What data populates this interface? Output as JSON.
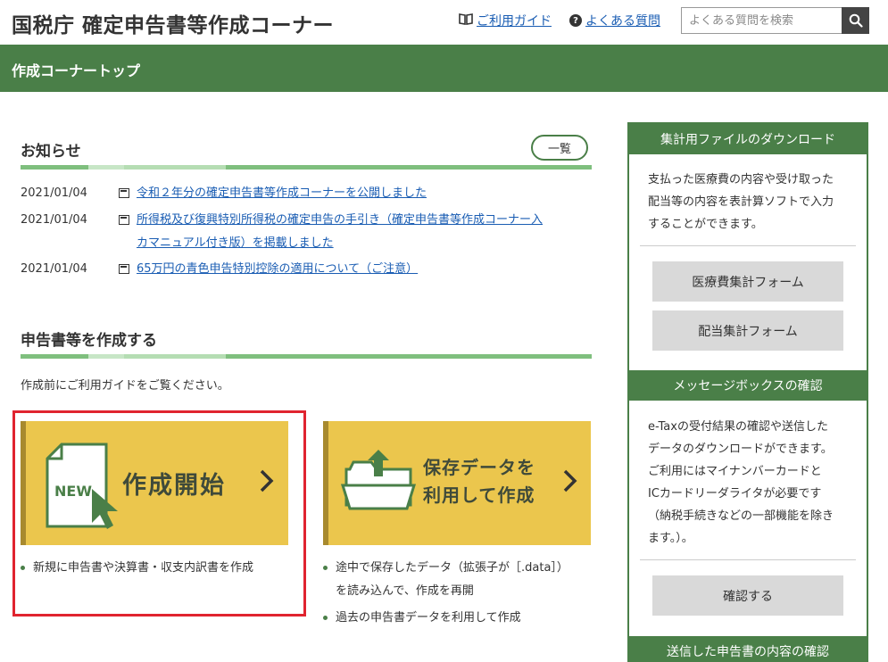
{
  "header": {
    "site_title": "国税庁 確定申告書等作成コーナー",
    "guide_link": "ご利用ガイド",
    "faq_link": "よくある質問",
    "search_placeholder": "よくある質問を検索"
  },
  "nav": {
    "current": "作成コーナートップ"
  },
  "news": {
    "title": "お知らせ",
    "list_button": "一覧",
    "items": [
      {
        "date": "2021/01/04",
        "text": "令和２年分の確定申告書等作成コーナーを公開しました"
      },
      {
        "date": "2021/01/04",
        "line1": "所得税及び復興特別所得税の確定申告の手引き（確定申告書等作成コーナー入",
        "line2": "カマニュアル付き版）を掲載しました"
      },
      {
        "date": "2021/01/04",
        "text": "65万円の青色申告特別控除の適用について（ご注意）"
      }
    ]
  },
  "create": {
    "title": "申告書等を作成する",
    "guide_text": "作成前にご利用ガイドをご覧ください。",
    "new_card": {
      "badge": "NEW",
      "title": "作成開始",
      "desc": "新規に申告書や決算書・収支内訳書を作成"
    },
    "saved_card": {
      "title_line1": "保存データを",
      "title_line2": "利用して作成",
      "desc1_line1": "途中で保存したデータ（拡張子が［.data］）",
      "desc1_line2": "を読み込んで、作成を再開",
      "desc2": "過去の申告書データを利用して作成"
    }
  },
  "sidebar": {
    "download": {
      "title": "集計用ファイルのダウンロード",
      "text_lines": [
        "支払った医療費の内容や受け取った",
        "配当等の内容を表計算ソフトで入力",
        "することができます。"
      ],
      "btn_medical": "医療費集計フォーム",
      "btn_dividend": "配当集計フォーム"
    },
    "messagebox": {
      "title": "メッセージボックスの確認",
      "text_lines": [
        "e-Taxの受付結果の確認や送信した",
        "データのダウンロードができます。",
        "ご利用にはマイナンバーカードと",
        "ICカードリーダライタが必要です",
        "（納税手続きなどの一部機能を除き",
        "ます。）。"
      ],
      "btn": "確認する"
    },
    "sent": {
      "title": "送信した申告書の内容の確認"
    }
  },
  "colors": {
    "brand_green": "#4a7f48",
    "card_yellow": "#ebc64d",
    "highlight_red": "#e0242f"
  }
}
